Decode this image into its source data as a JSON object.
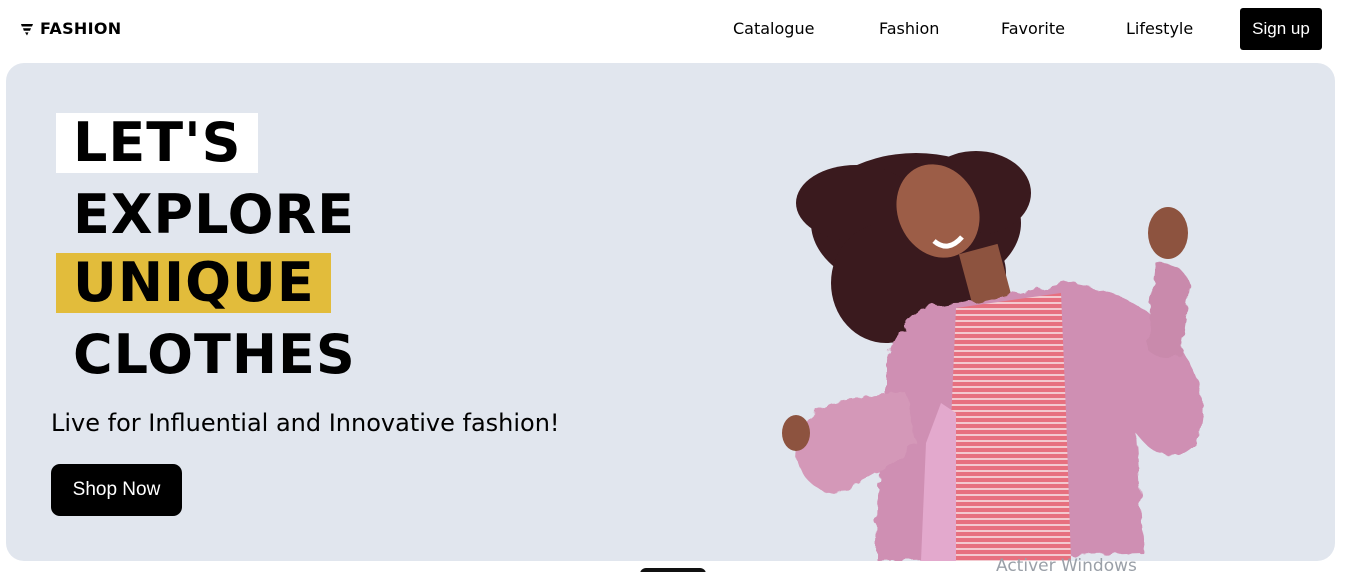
{
  "brand": {
    "name": "FASHION",
    "icon": "fashion-logo-icon"
  },
  "nav": {
    "items": [
      {
        "label": "Catalogue"
      },
      {
        "label": "Fashion"
      },
      {
        "label": "Favorite"
      },
      {
        "label": "Lifestyle"
      }
    ],
    "signup_label": "Sign up"
  },
  "hero": {
    "headline": [
      "LET'S",
      "EXPLORE",
      "UNIQUE",
      "CLOTHES"
    ],
    "tagline": "Live for Influential and Innovative fashion!",
    "cta_label": "Shop Now",
    "background_color": "#e1e6ee",
    "highlight_color": "#e2bc3b",
    "image": "woman-in-pink-fur-coat-dancing"
  },
  "os_watermark": "Activer Windows"
}
